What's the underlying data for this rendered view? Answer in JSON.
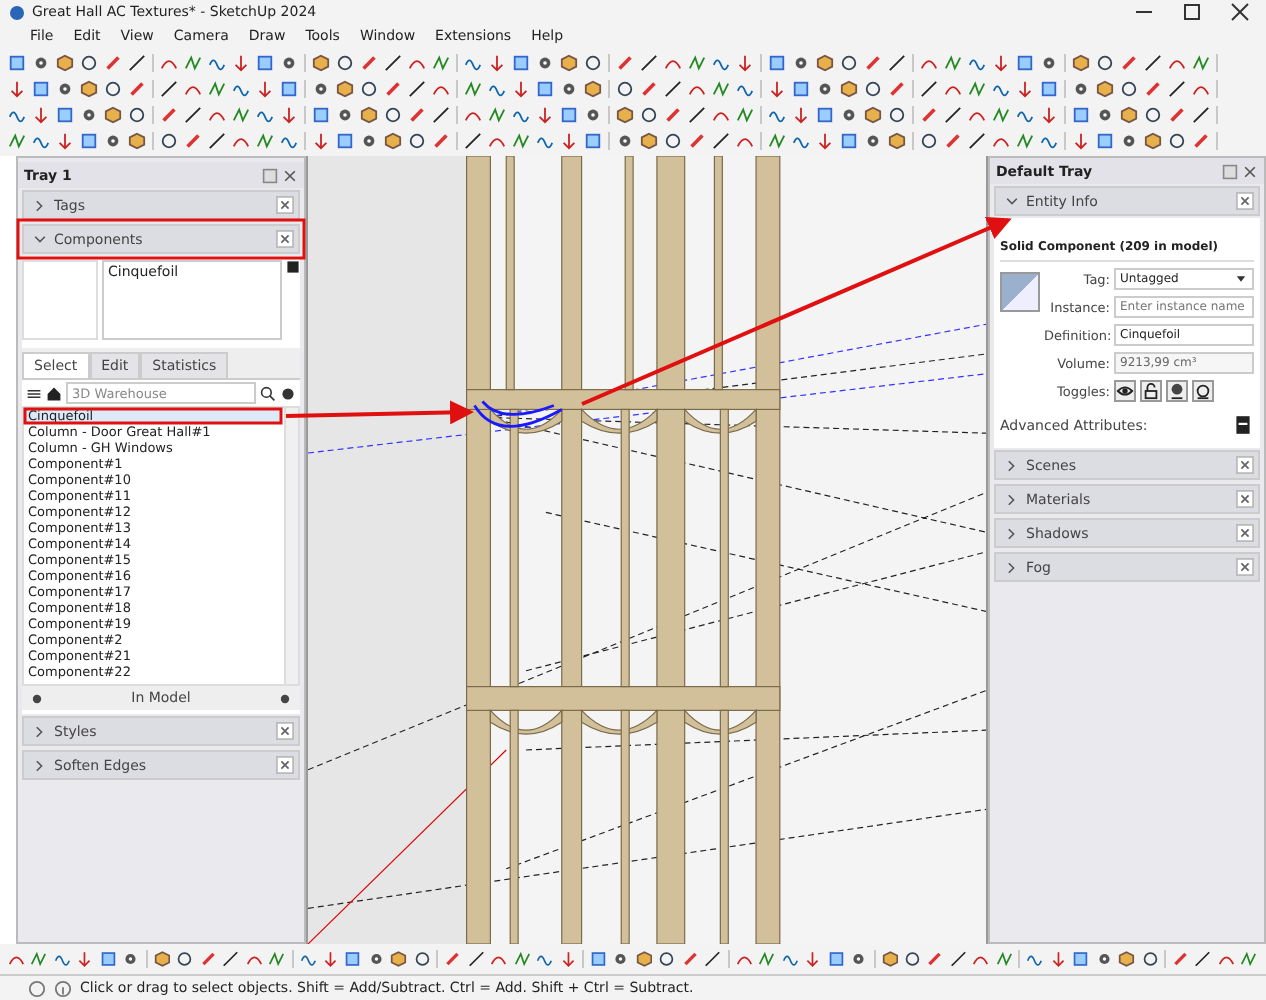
{
  "window": {
    "title": "Great Hall AC Textures* - SketchUp 2024"
  },
  "menu": [
    "File",
    "Edit",
    "View",
    "Camera",
    "Draw",
    "Tools",
    "Window",
    "Extensions",
    "Help"
  ],
  "left_tray": {
    "title": "Tray 1",
    "panels_top": [
      {
        "label": "Tags",
        "expanded": false
      }
    ],
    "components": {
      "label": "Components",
      "expanded": true,
      "name": "Cinquefoil",
      "tabs": [
        {
          "label": "Select",
          "selected": true
        },
        {
          "label": "Edit",
          "selected": false
        },
        {
          "label": "Statistics",
          "selected": false
        }
      ],
      "search": {
        "placeholder": "3D Warehouse"
      },
      "items": [
        {
          "label": "Cinquefoil",
          "selected": true
        },
        {
          "label": "Column - Door Great Hall#1",
          "selected": false
        },
        {
          "label": "Column - GH Windows",
          "selected": false
        },
        {
          "label": "Component#1",
          "selected": false
        },
        {
          "label": "Component#10",
          "selected": false
        },
        {
          "label": "Component#11",
          "selected": false
        },
        {
          "label": "Component#12",
          "selected": false
        },
        {
          "label": "Component#13",
          "selected": false
        },
        {
          "label": "Component#14",
          "selected": false
        },
        {
          "label": "Component#15",
          "selected": false
        },
        {
          "label": "Component#16",
          "selected": false
        },
        {
          "label": "Component#17",
          "selected": false
        },
        {
          "label": "Component#18",
          "selected": false
        },
        {
          "label": "Component#19",
          "selected": false
        },
        {
          "label": "Component#2",
          "selected": false
        },
        {
          "label": "Component#21",
          "selected": false
        },
        {
          "label": "Component#22",
          "selected": false
        }
      ],
      "footer": "In Model"
    },
    "panels_bottom": [
      {
        "label": "Styles",
        "expanded": false
      },
      {
        "label": "Soften Edges",
        "expanded": false
      }
    ]
  },
  "right_tray": {
    "title": "Default Tray",
    "entity_info": {
      "label": "Entity Info",
      "expanded": true,
      "heading": "Solid Component (209 in model)",
      "fields": [
        {
          "kind": "dropdown",
          "label": "Tag:",
          "value": "Untagged"
        },
        {
          "kind": "input",
          "label": "Instance:",
          "placeholder": "Enter instance name"
        },
        {
          "kind": "input",
          "label": "Definition:",
          "value": "Cinquefoil"
        },
        {
          "kind": "readonly",
          "label": "Volume:",
          "value": "9213,99 cm³"
        }
      ],
      "toggles_label": "Toggles:",
      "advanced_label": "Advanced Attributes:"
    },
    "panels": [
      {
        "label": "Scenes",
        "expanded": false
      },
      {
        "label": "Materials",
        "expanded": false
      },
      {
        "label": "Shadows",
        "expanded": false
      },
      {
        "label": "Fog",
        "expanded": false
      }
    ]
  },
  "status_bar": {
    "text": "Click or drag to select objects. Shift = Add/Subtract. Ctrl = Add. Shift + Ctrl = Subtract."
  }
}
